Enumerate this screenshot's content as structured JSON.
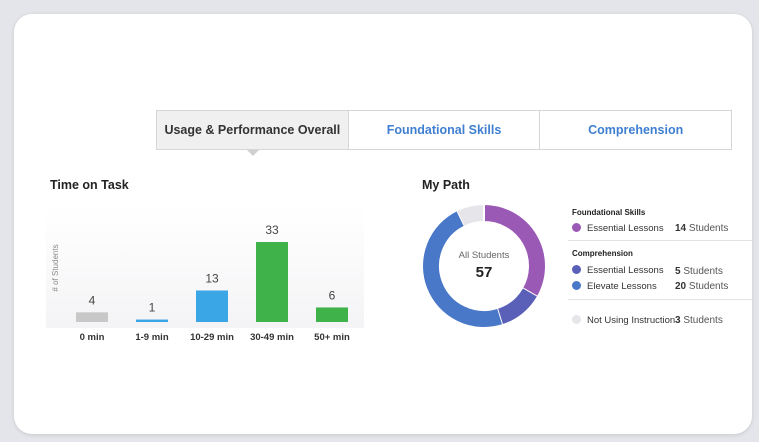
{
  "tabs": [
    {
      "label": "Usage & Performance Overall",
      "active": true
    },
    {
      "label": "Foundational Skills",
      "active": false
    },
    {
      "label": "Comprehension",
      "active": false
    }
  ],
  "time_on_task": {
    "title": "Time on Task"
  },
  "my_path": {
    "title": "My Path",
    "center_label": "All Students",
    "center_value": "57",
    "groups": [
      {
        "heading": "Foundational Skills",
        "items": [
          {
            "label": "Essential Lessons",
            "count": "14",
            "unit": "Students",
            "color": "#9b59b6"
          }
        ]
      },
      {
        "heading": "Comprehension",
        "items": [
          {
            "label": "Essential Lessons",
            "count": "5",
            "unit": "Students",
            "color": "#5a5fb8"
          },
          {
            "label": "Elevate Lessons",
            "count": "20",
            "unit": "Students",
            "color": "#4a78c8"
          }
        ]
      },
      {
        "heading": "",
        "items": [
          {
            "label": "Not Using Instruction",
            "count": "3",
            "unit": "Students",
            "color": "#e6e6ea"
          }
        ]
      }
    ]
  },
  "chart_data": [
    {
      "type": "bar",
      "title": "Time on Task",
      "ylabel": "# of Students",
      "categories": [
        "0 min",
        "1-9 min",
        "10-29 min",
        "30-49 min",
        "50+ min"
      ],
      "values": [
        4,
        1,
        13,
        33,
        6
      ],
      "colors": [
        "#c8c8c8",
        "#3aa6e5",
        "#3aa6e5",
        "#3fb24a",
        "#3fb24a"
      ],
      "ylim": [
        0,
        33
      ]
    },
    {
      "type": "pie",
      "title": "My Path",
      "categories": [
        "Foundational Skills Essential Lessons",
        "Comprehension Essential Lessons",
        "Comprehension Elevate Lessons",
        "Not Using Instruction"
      ],
      "values": [
        14,
        5,
        20,
        3
      ],
      "colors": [
        "#9b59b6",
        "#5a5fb8",
        "#4a78c8",
        "#e6e6ea"
      ]
    }
  ]
}
